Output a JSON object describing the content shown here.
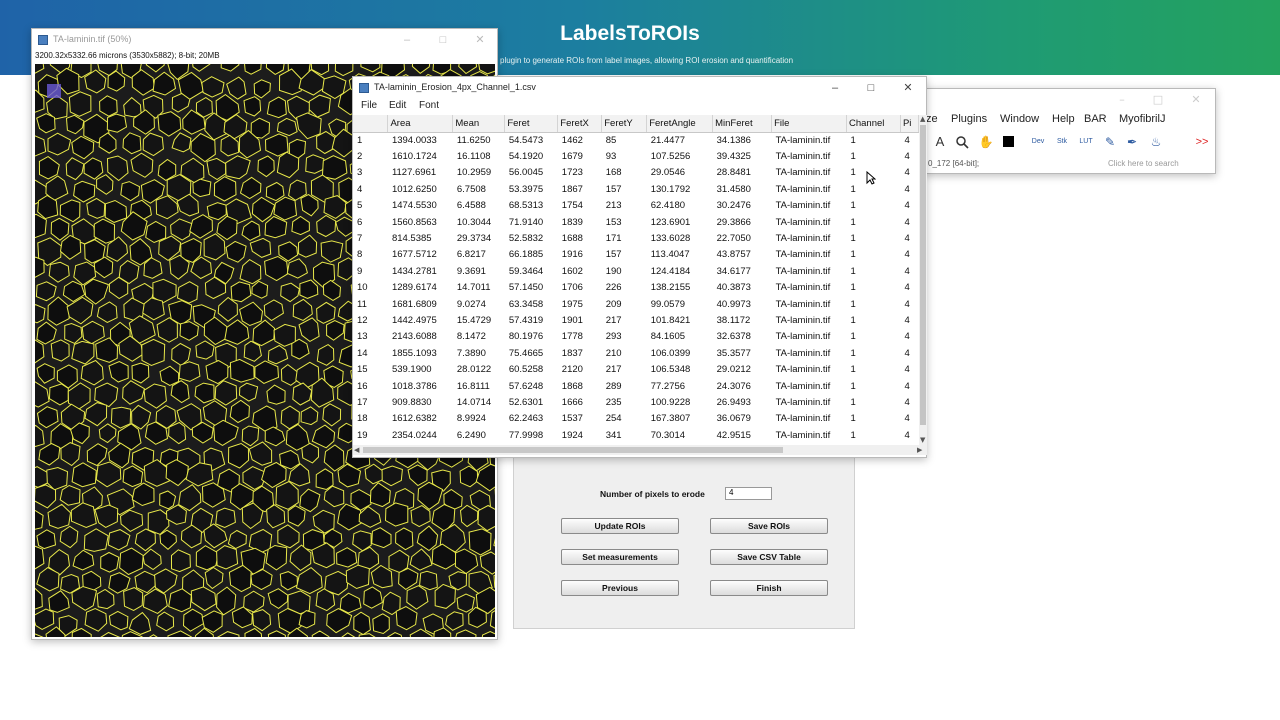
{
  "banner": {
    "title": "LabelsToROIs",
    "subtitle": "plugin to generate ROIs from label images, allowing ROI erosion and quantification"
  },
  "image_window": {
    "title": "TA-laminin.tif (50%)",
    "info": "3200.32x5332.66 microns (3530x5882); 8-bit; 20MB"
  },
  "csv_window": {
    "title": "TA-laminin_Erosion_4px_Channel_1.csv",
    "menu": [
      "File",
      "Edit",
      "Font"
    ],
    "columns": [
      "",
      "Area",
      "Mean",
      "Feret",
      "FeretX",
      "FeretY",
      "FeretAngle",
      "MinFeret",
      "File",
      "Channel",
      "Pi"
    ],
    "rows": [
      [
        "1",
        "1394.0033",
        "11.6250",
        "54.5473",
        "1462",
        "85",
        "21.4477",
        "34.1386",
        "TA-laminin.tif",
        "1",
        "4"
      ],
      [
        "2",
        "1610.1724",
        "16.1108",
        "54.1920",
        "1679",
        "93",
        "107.5256",
        "39.4325",
        "TA-laminin.tif",
        "1",
        "4"
      ],
      [
        "3",
        "1127.6961",
        "10.2959",
        "56.0045",
        "1723",
        "168",
        "29.0546",
        "28.8481",
        "TA-laminin.tif",
        "1",
        "4"
      ],
      [
        "4",
        "1012.6250",
        "6.7508",
        "53.3975",
        "1867",
        "157",
        "130.1792",
        "31.4580",
        "TA-laminin.tif",
        "1",
        "4"
      ],
      [
        "5",
        "1474.5530",
        "6.4588",
        "68.5313",
        "1754",
        "213",
        "62.4180",
        "30.2476",
        "TA-laminin.tif",
        "1",
        "4"
      ],
      [
        "6",
        "1560.8563",
        "10.3044",
        "71.9140",
        "1839",
        "153",
        "123.6901",
        "29.3866",
        "TA-laminin.tif",
        "1",
        "4"
      ],
      [
        "7",
        "814.5385",
        "29.3734",
        "52.5832",
        "1688",
        "171",
        "133.6028",
        "22.7050",
        "TA-laminin.tif",
        "1",
        "4"
      ],
      [
        "8",
        "1677.5712",
        "6.8217",
        "66.1885",
        "1916",
        "157",
        "113.4047",
        "43.8757",
        "TA-laminin.tif",
        "1",
        "4"
      ],
      [
        "9",
        "1434.2781",
        "9.3691",
        "59.3464",
        "1602",
        "190",
        "124.4184",
        "34.6177",
        "TA-laminin.tif",
        "1",
        "4"
      ],
      [
        "10",
        "1289.6174",
        "14.7011",
        "57.1450",
        "1706",
        "226",
        "138.2155",
        "40.3873",
        "TA-laminin.tif",
        "1",
        "4"
      ],
      [
        "11",
        "1681.6809",
        "9.0274",
        "63.3458",
        "1975",
        "209",
        "99.0579",
        "40.9973",
        "TA-laminin.tif",
        "1",
        "4"
      ],
      [
        "12",
        "1442.4975",
        "15.4729",
        "57.4319",
        "1901",
        "217",
        "101.8421",
        "38.1172",
        "TA-laminin.tif",
        "1",
        "4"
      ],
      [
        "13",
        "2143.6088",
        "8.1472",
        "80.1976",
        "1778",
        "293",
        "84.1605",
        "32.6378",
        "TA-laminin.tif",
        "1",
        "4"
      ],
      [
        "14",
        "1855.1093",
        "7.3890",
        "75.4665",
        "1837",
        "210",
        "106.0399",
        "35.3577",
        "TA-laminin.tif",
        "1",
        "4"
      ],
      [
        "15",
        "539.1900",
        "28.0122",
        "60.5258",
        "2120",
        "217",
        "106.5348",
        "29.0212",
        "TA-laminin.tif",
        "1",
        "4"
      ],
      [
        "16",
        "1018.3786",
        "16.8111",
        "57.6248",
        "1868",
        "289",
        "77.2756",
        "24.3076",
        "TA-laminin.tif",
        "1",
        "4"
      ],
      [
        "17",
        "909.8830",
        "14.0714",
        "52.6301",
        "1666",
        "235",
        "100.9228",
        "26.9493",
        "TA-laminin.tif",
        "1",
        "4"
      ],
      [
        "18",
        "1612.6382",
        "8.9924",
        "62.2463",
        "1537",
        "254",
        "167.3807",
        "36.0679",
        "TA-laminin.tif",
        "1",
        "4"
      ],
      [
        "19",
        "2354.0244",
        "6.2490",
        "77.9998",
        "1924",
        "341",
        "70.3014",
        "42.9515",
        "TA-laminin.tif",
        "1",
        "4"
      ]
    ]
  },
  "imagej_window": {
    "menu": [
      "ze",
      "Plugins",
      "Window",
      "Help",
      "BAR",
      "MyofibrilJ"
    ],
    "status": "0_172 [64-bit];",
    "search_placeholder": "Click here to search",
    "tools": [
      "A",
      "Q",
      "H",
      "C",
      "Dev",
      "Stk",
      "LUT",
      "P",
      "B",
      "D",
      ">>"
    ]
  },
  "dialog": {
    "erode_label": "Number of pixels to erode",
    "erode_value": "4",
    "buttons": {
      "update": "Update ROIs",
      "save_rois": "Save ROIs",
      "set_measurements": "Set measurements",
      "save_csv": "Save CSV Table",
      "previous": "Previous",
      "finish": "Finish"
    }
  },
  "colors": {
    "banner_start": "#1f63a8",
    "banner_end": "#24a25e",
    "roi_outline": "#e8e84a",
    "tissue": "#1c1c1c"
  }
}
